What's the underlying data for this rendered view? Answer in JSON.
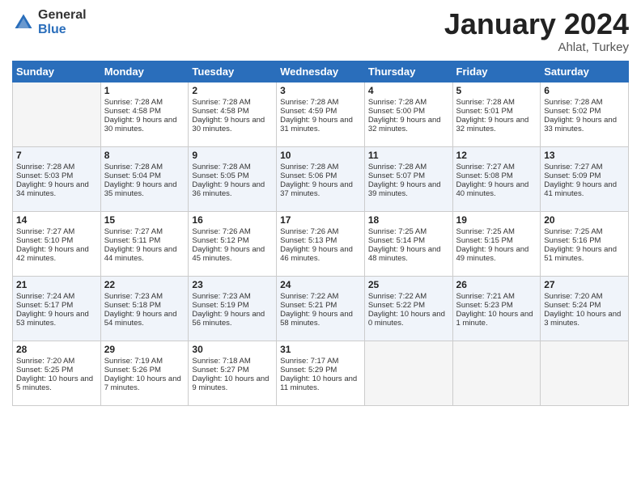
{
  "logo": {
    "general": "General",
    "blue": "Blue"
  },
  "title": "January 2024",
  "location": "Ahlat, Turkey",
  "days_header": [
    "Sunday",
    "Monday",
    "Tuesday",
    "Wednesday",
    "Thursday",
    "Friday",
    "Saturday"
  ],
  "weeks": [
    [
      {
        "empty": true
      },
      {
        "day": "1",
        "sunrise": "Sunrise: 7:28 AM",
        "sunset": "Sunset: 4:58 PM",
        "daylight": "Daylight: 9 hours and 30 minutes."
      },
      {
        "day": "2",
        "sunrise": "Sunrise: 7:28 AM",
        "sunset": "Sunset: 4:58 PM",
        "daylight": "Daylight: 9 hours and 30 minutes."
      },
      {
        "day": "3",
        "sunrise": "Sunrise: 7:28 AM",
        "sunset": "Sunset: 4:59 PM",
        "daylight": "Daylight: 9 hours and 31 minutes."
      },
      {
        "day": "4",
        "sunrise": "Sunrise: 7:28 AM",
        "sunset": "Sunset: 5:00 PM",
        "daylight": "Daylight: 9 hours and 32 minutes."
      },
      {
        "day": "5",
        "sunrise": "Sunrise: 7:28 AM",
        "sunset": "Sunset: 5:01 PM",
        "daylight": "Daylight: 9 hours and 32 minutes."
      },
      {
        "day": "6",
        "sunrise": "Sunrise: 7:28 AM",
        "sunset": "Sunset: 5:02 PM",
        "daylight": "Daylight: 9 hours and 33 minutes."
      }
    ],
    [
      {
        "day": "7",
        "sunrise": "Sunrise: 7:28 AM",
        "sunset": "Sunset: 5:03 PM",
        "daylight": "Daylight: 9 hours and 34 minutes."
      },
      {
        "day": "8",
        "sunrise": "Sunrise: 7:28 AM",
        "sunset": "Sunset: 5:04 PM",
        "daylight": "Daylight: 9 hours and 35 minutes."
      },
      {
        "day": "9",
        "sunrise": "Sunrise: 7:28 AM",
        "sunset": "Sunset: 5:05 PM",
        "daylight": "Daylight: 9 hours and 36 minutes."
      },
      {
        "day": "10",
        "sunrise": "Sunrise: 7:28 AM",
        "sunset": "Sunset: 5:06 PM",
        "daylight": "Daylight: 9 hours and 37 minutes."
      },
      {
        "day": "11",
        "sunrise": "Sunrise: 7:28 AM",
        "sunset": "Sunset: 5:07 PM",
        "daylight": "Daylight: 9 hours and 39 minutes."
      },
      {
        "day": "12",
        "sunrise": "Sunrise: 7:27 AM",
        "sunset": "Sunset: 5:08 PM",
        "daylight": "Daylight: 9 hours and 40 minutes."
      },
      {
        "day": "13",
        "sunrise": "Sunrise: 7:27 AM",
        "sunset": "Sunset: 5:09 PM",
        "daylight": "Daylight: 9 hours and 41 minutes."
      }
    ],
    [
      {
        "day": "14",
        "sunrise": "Sunrise: 7:27 AM",
        "sunset": "Sunset: 5:10 PM",
        "daylight": "Daylight: 9 hours and 42 minutes."
      },
      {
        "day": "15",
        "sunrise": "Sunrise: 7:27 AM",
        "sunset": "Sunset: 5:11 PM",
        "daylight": "Daylight: 9 hours and 44 minutes."
      },
      {
        "day": "16",
        "sunrise": "Sunrise: 7:26 AM",
        "sunset": "Sunset: 5:12 PM",
        "daylight": "Daylight: 9 hours and 45 minutes."
      },
      {
        "day": "17",
        "sunrise": "Sunrise: 7:26 AM",
        "sunset": "Sunset: 5:13 PM",
        "daylight": "Daylight: 9 hours and 46 minutes."
      },
      {
        "day": "18",
        "sunrise": "Sunrise: 7:25 AM",
        "sunset": "Sunset: 5:14 PM",
        "daylight": "Daylight: 9 hours and 48 minutes."
      },
      {
        "day": "19",
        "sunrise": "Sunrise: 7:25 AM",
        "sunset": "Sunset: 5:15 PM",
        "daylight": "Daylight: 9 hours and 49 minutes."
      },
      {
        "day": "20",
        "sunrise": "Sunrise: 7:25 AM",
        "sunset": "Sunset: 5:16 PM",
        "daylight": "Daylight: 9 hours and 51 minutes."
      }
    ],
    [
      {
        "day": "21",
        "sunrise": "Sunrise: 7:24 AM",
        "sunset": "Sunset: 5:17 PM",
        "daylight": "Daylight: 9 hours and 53 minutes."
      },
      {
        "day": "22",
        "sunrise": "Sunrise: 7:23 AM",
        "sunset": "Sunset: 5:18 PM",
        "daylight": "Daylight: 9 hours and 54 minutes."
      },
      {
        "day": "23",
        "sunrise": "Sunrise: 7:23 AM",
        "sunset": "Sunset: 5:19 PM",
        "daylight": "Daylight: 9 hours and 56 minutes."
      },
      {
        "day": "24",
        "sunrise": "Sunrise: 7:22 AM",
        "sunset": "Sunset: 5:21 PM",
        "daylight": "Daylight: 9 hours and 58 minutes."
      },
      {
        "day": "25",
        "sunrise": "Sunrise: 7:22 AM",
        "sunset": "Sunset: 5:22 PM",
        "daylight": "Daylight: 10 hours and 0 minutes."
      },
      {
        "day": "26",
        "sunrise": "Sunrise: 7:21 AM",
        "sunset": "Sunset: 5:23 PM",
        "daylight": "Daylight: 10 hours and 1 minute."
      },
      {
        "day": "27",
        "sunrise": "Sunrise: 7:20 AM",
        "sunset": "Sunset: 5:24 PM",
        "daylight": "Daylight: 10 hours and 3 minutes."
      }
    ],
    [
      {
        "day": "28",
        "sunrise": "Sunrise: 7:20 AM",
        "sunset": "Sunset: 5:25 PM",
        "daylight": "Daylight: 10 hours and 5 minutes."
      },
      {
        "day": "29",
        "sunrise": "Sunrise: 7:19 AM",
        "sunset": "Sunset: 5:26 PM",
        "daylight": "Daylight: 10 hours and 7 minutes."
      },
      {
        "day": "30",
        "sunrise": "Sunrise: 7:18 AM",
        "sunset": "Sunset: 5:27 PM",
        "daylight": "Daylight: 10 hours and 9 minutes."
      },
      {
        "day": "31",
        "sunrise": "Sunrise: 7:17 AM",
        "sunset": "Sunset: 5:29 PM",
        "daylight": "Daylight: 10 hours and 11 minutes."
      },
      {
        "empty": true
      },
      {
        "empty": true
      },
      {
        "empty": true
      }
    ]
  ]
}
